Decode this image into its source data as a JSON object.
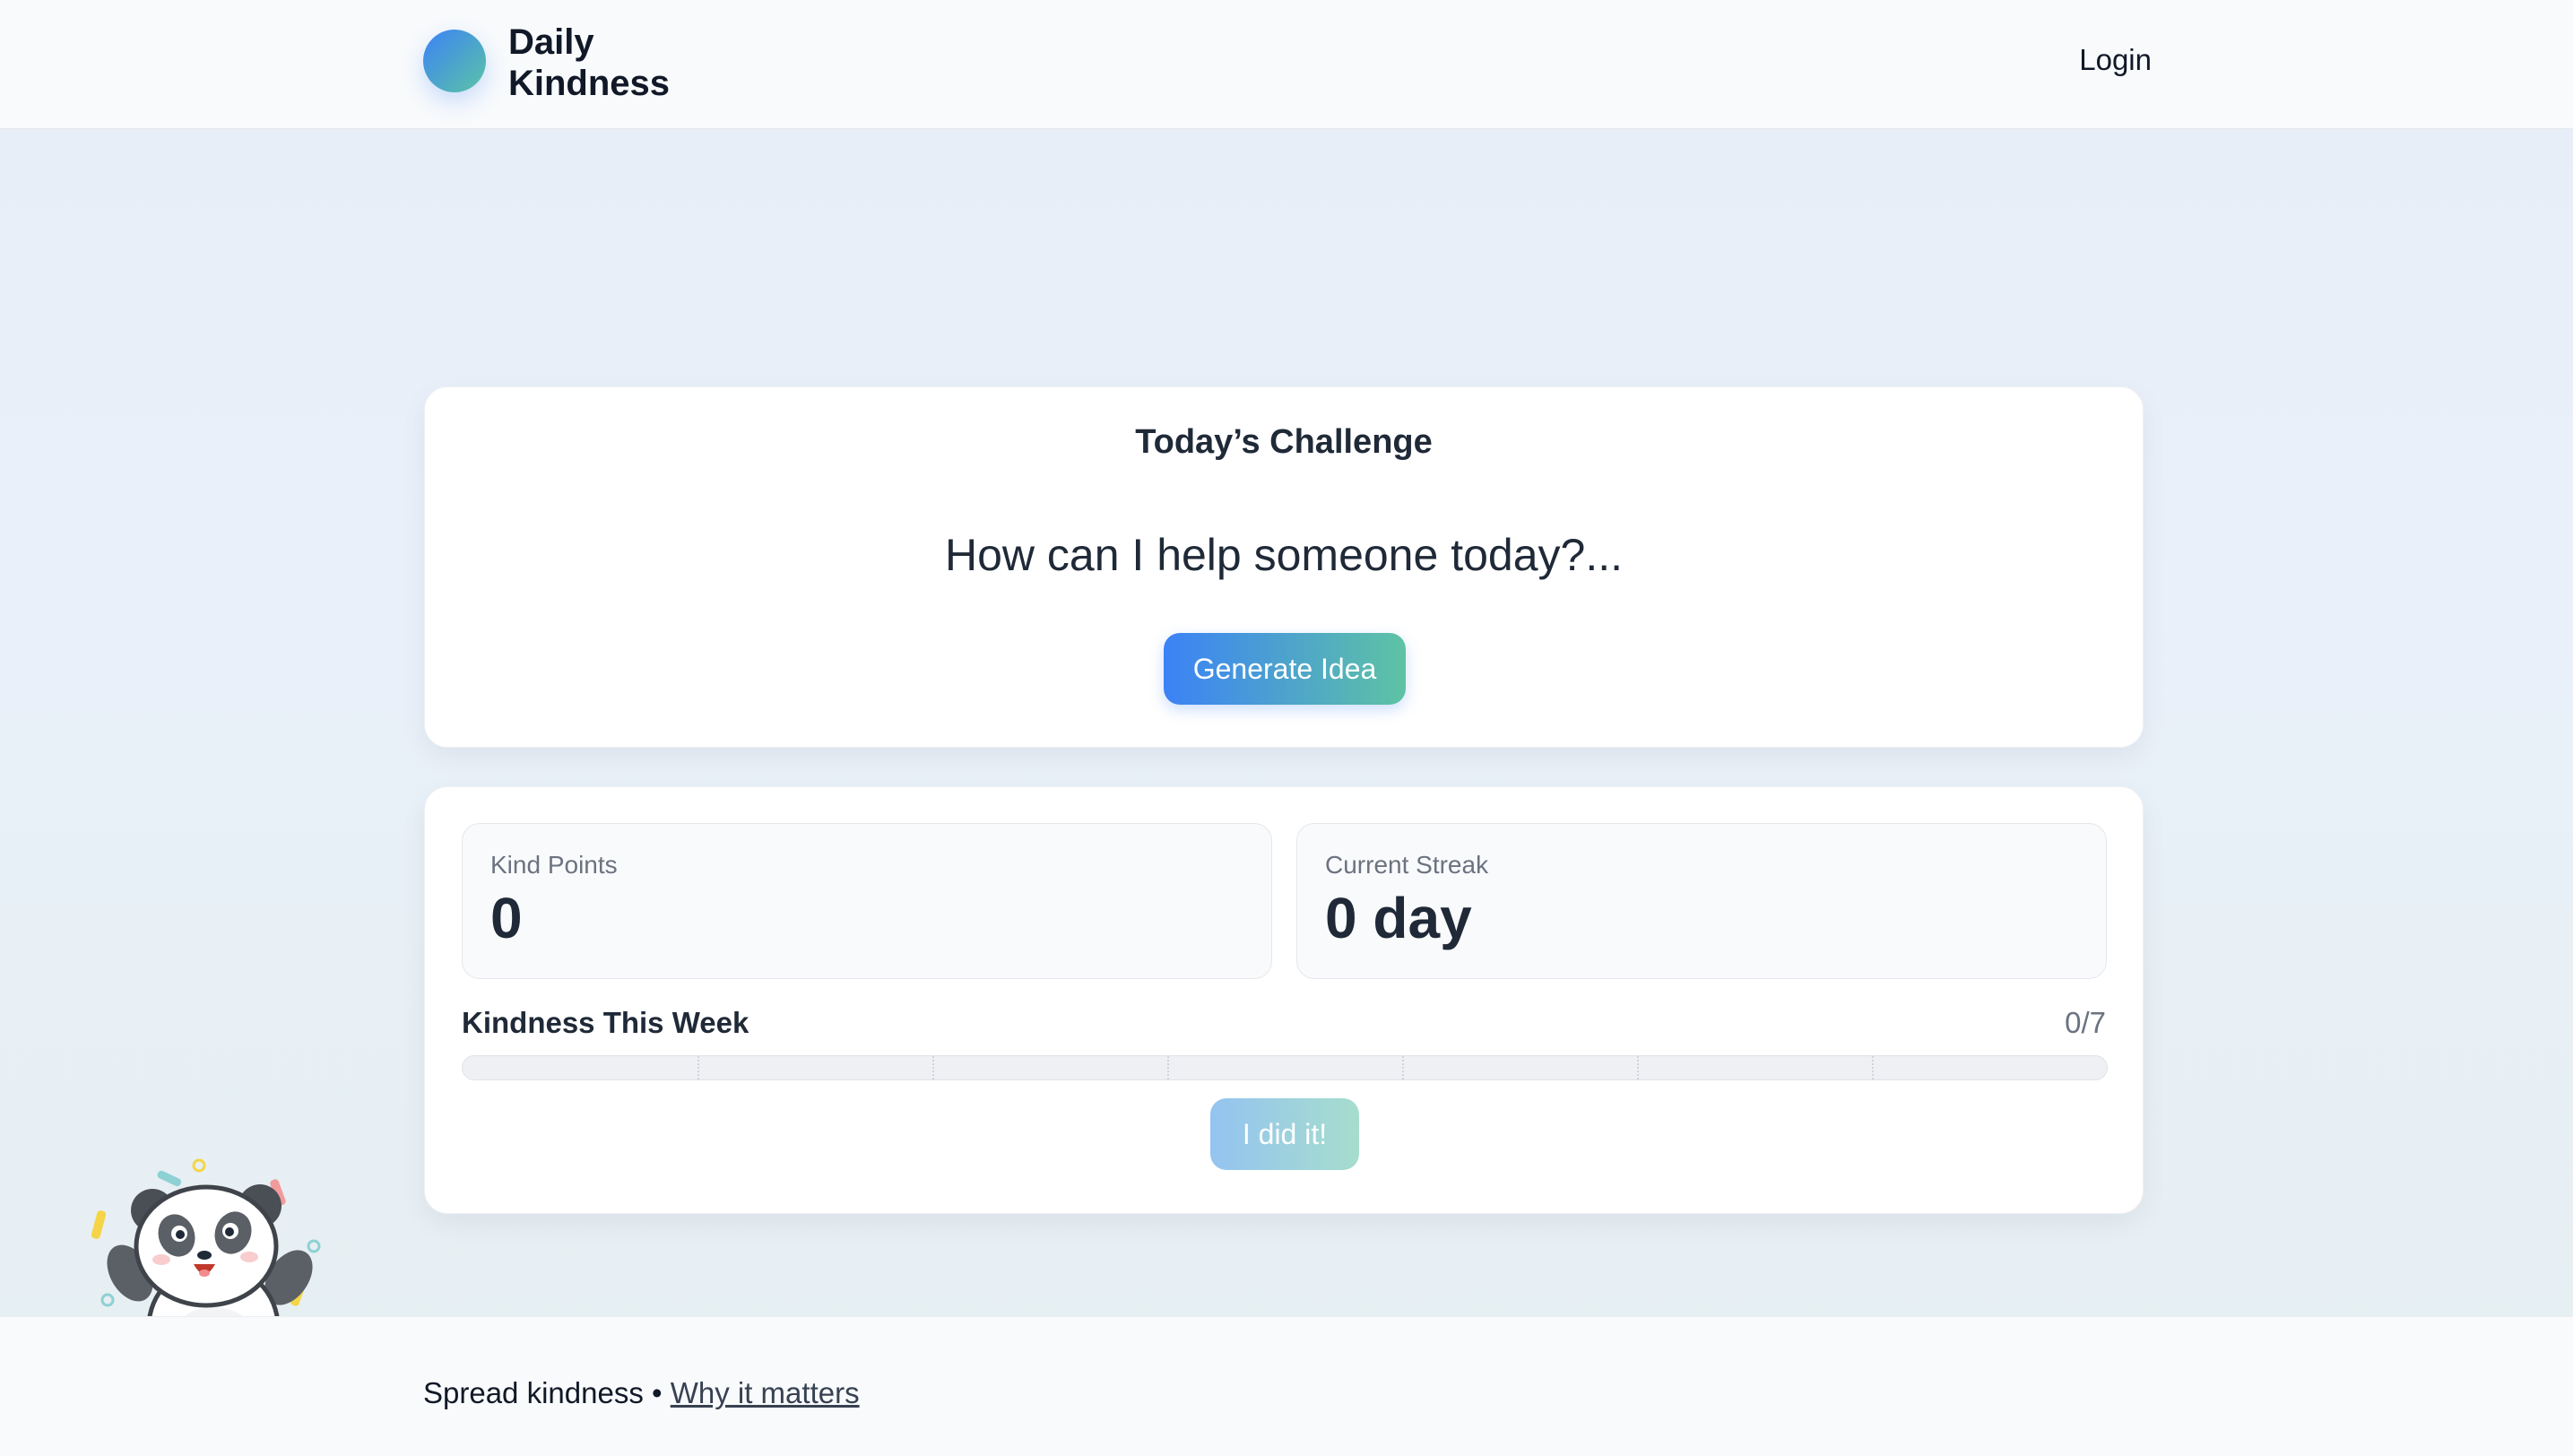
{
  "header": {
    "brand_line1": "Daily",
    "brand_line2": "Kindness",
    "login_label": "Login"
  },
  "challenge": {
    "title": "Today’s Challenge",
    "prompt": "How can I help someone today?...",
    "generate_label": "Generate Idea"
  },
  "stats": {
    "points_label": "Kind Points",
    "points_value": "0",
    "streak_label": "Current Streak",
    "streak_value": "0 day"
  },
  "week": {
    "title": "Kindness This Week",
    "count": "0/7",
    "completed": 0,
    "total": 7
  },
  "did_it_label": "I did it!",
  "footer": {
    "text": "Spread kindness •",
    "link": "Why it matters"
  },
  "colors": {
    "accent_start": "#3b82f6",
    "accent_end": "#5ec3a4",
    "text": "#1f2937"
  },
  "icons": {
    "mascot": "panda-mascot-icon"
  }
}
